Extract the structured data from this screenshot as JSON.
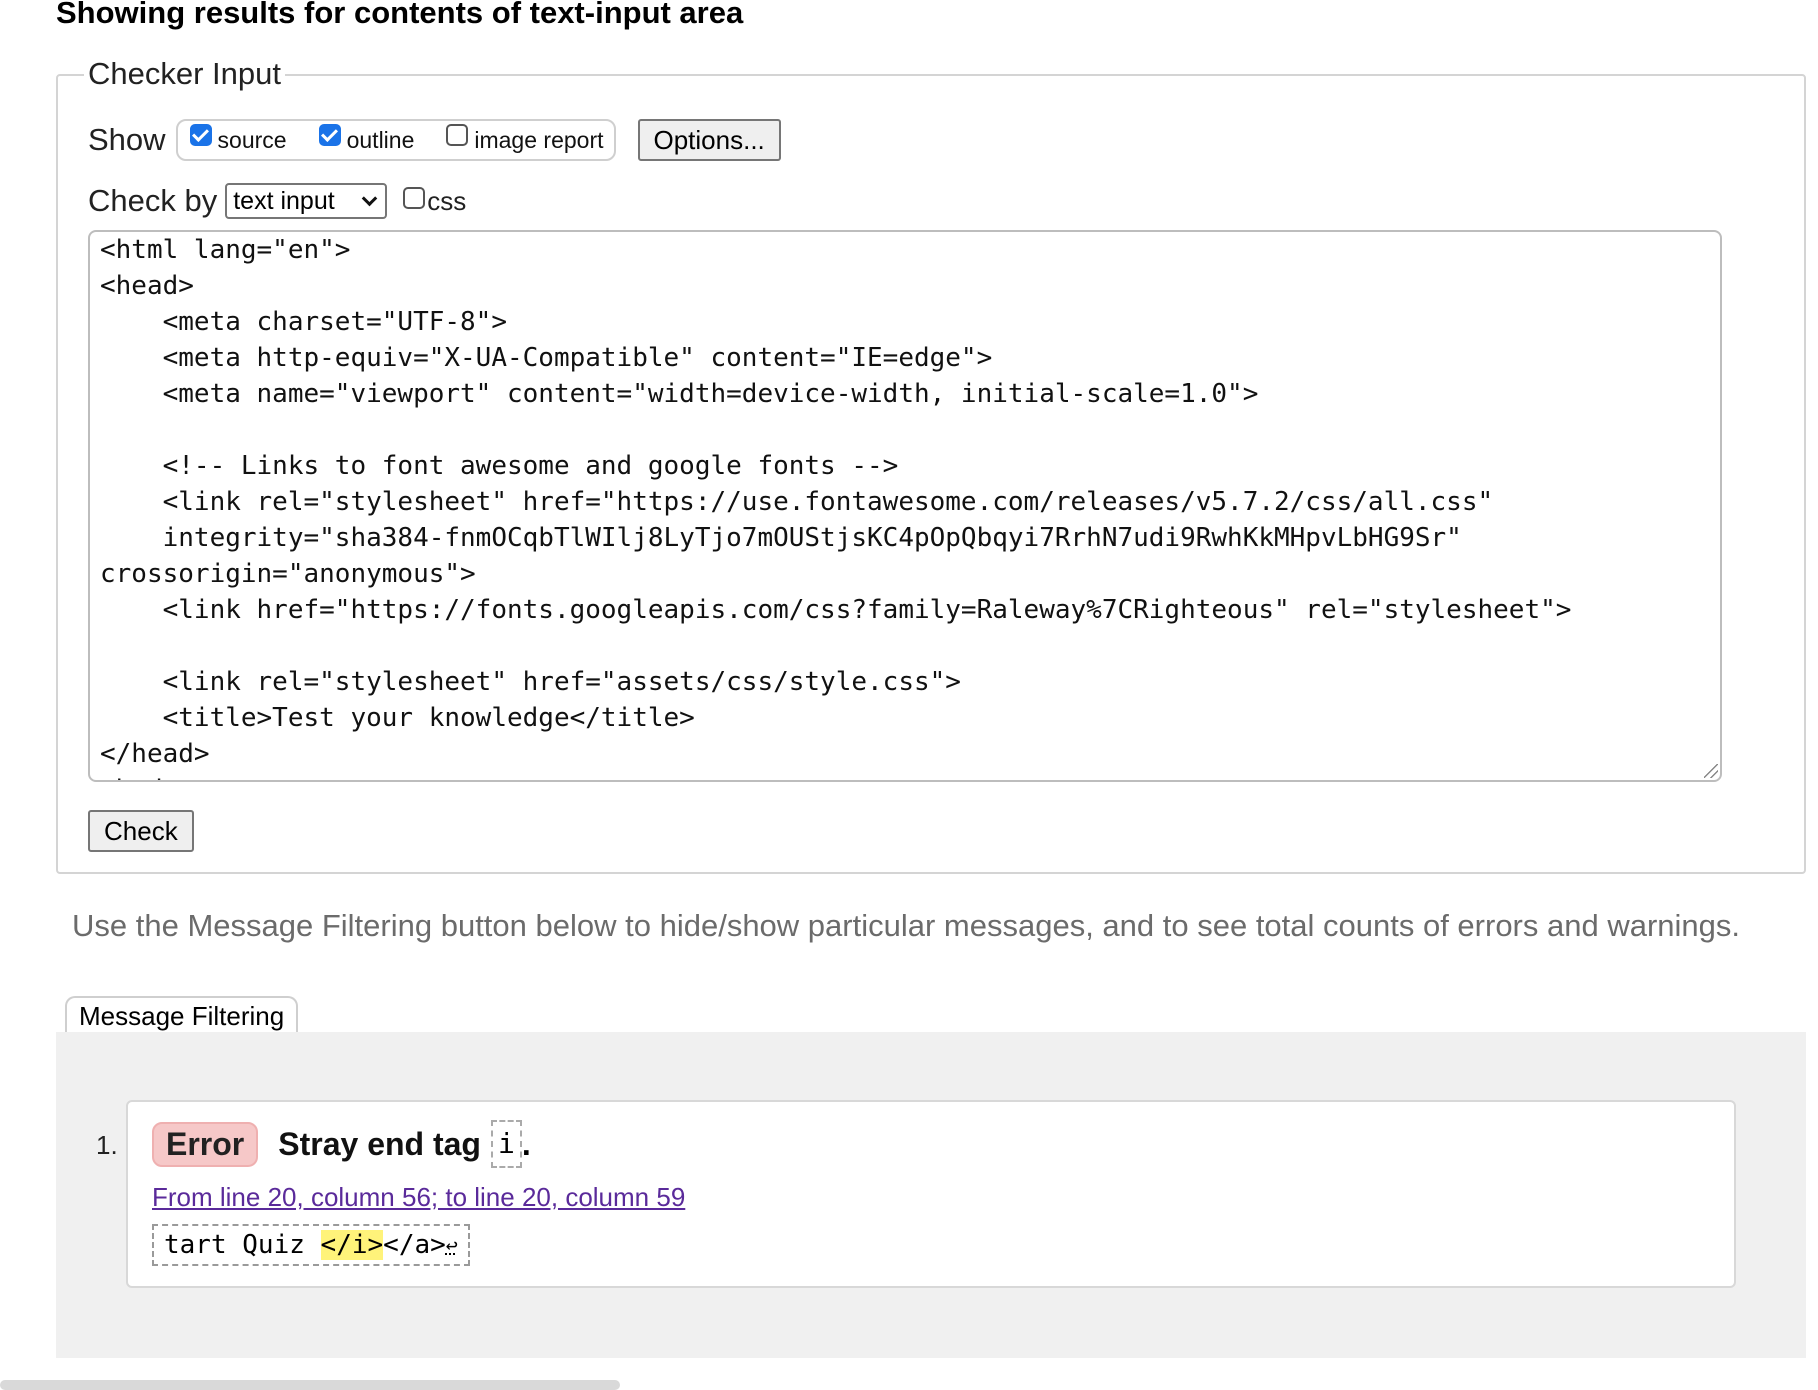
{
  "heading": "Showing results for contents of text-input area",
  "checker": {
    "legend": "Checker Input",
    "show_label": "Show",
    "show_options": [
      {
        "label": "source",
        "checked": true
      },
      {
        "label": "outline",
        "checked": true
      },
      {
        "label": "image report",
        "checked": false
      }
    ],
    "options_button": "Options...",
    "check_by_label": "Check by",
    "check_by_value": "text input",
    "css_label": "css",
    "css_checked": false,
    "source_text": "<html lang=\"en\">\n<head>\n    <meta charset=\"UTF-8\">\n    <meta http-equiv=\"X-UA-Compatible\" content=\"IE=edge\">\n    <meta name=\"viewport\" content=\"width=device-width, initial-scale=1.0\">\n\n    <!-- Links to font awesome and google fonts -->\n    <link rel=\"stylesheet\" href=\"https://use.fontawesome.com/releases/v5.7.2/css/all.css\"\n    integrity=\"sha384-fnmOCqbTlWIlj8LyTjo7mOUStjsKC4pOpQbqyi7RrhN7udi9RwhKkMHpvLbHG9Sr\"\ncrossorigin=\"anonymous\">\n    <link href=\"https://fonts.googleapis.com/css?family=Raleway%7CRighteous\" rel=\"stylesheet\">\n\n    <link rel=\"stylesheet\" href=\"assets/css/style.css\">\n    <title>Test your knowledge</title>\n</head>\n<body>",
    "check_button": "Check"
  },
  "filter_note": "Use the Message Filtering button below to hide/show particular messages, and to see total counts of errors and warnings.",
  "filter_button": "Message Filtering",
  "messages": [
    {
      "number": "1.",
      "type": "Error",
      "text": "Stray end tag",
      "code": "i",
      "period": ".",
      "location": "From line 20, column 56; to line 20, column 59",
      "extract_before": "tart Quiz ",
      "extract_highlight": "</i>",
      "extract_after": "</a>",
      "extract_linefeed": "↩"
    }
  ],
  "colors": {
    "error_badge": "#f6c8c8",
    "link": "#5a2a9a",
    "highlight": "#fff37a",
    "checkbox_checked": "#1a73e8"
  }
}
